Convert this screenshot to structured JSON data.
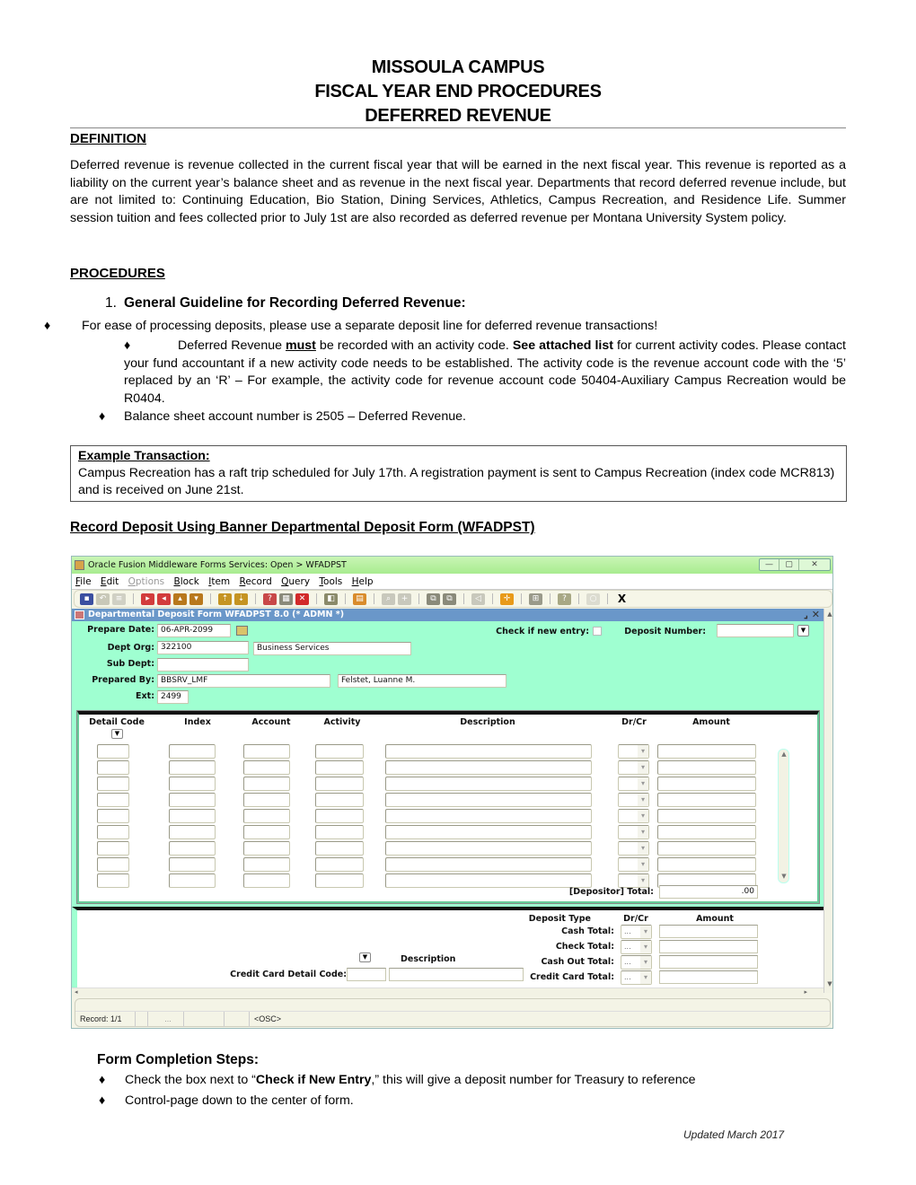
{
  "document": {
    "titles": [
      "MISSOULA CAMPUS",
      "FISCAL YEAR END PROCEDURES",
      "DEFERRED REVENUE"
    ],
    "definition": {
      "heading": "DEFINITION",
      "text": "Deferred revenue is revenue collected in the current fiscal year that will be earned in the next fiscal year. This revenue is reported as a liability on the current year’s balance sheet and as revenue in the next fiscal year. Departments that record deferred revenue include, but are not limited to: Continuing Education, Bio Station, Dining Services, Athletics, Campus Recreation, and Residence Life. Summer session tuition and fees collected prior to July 1st are also recorded as deferred revenue per Montana University System policy."
    },
    "procedures": {
      "heading": "PROCEDURES",
      "step_number": "1.",
      "step_title": "General Guideline for Recording Deferred Revenue:",
      "bullet_symbol": "♦",
      "bullet1": "For ease of processing deposits, please use a separate deposit line for deferred revenue transactions!",
      "bullet2_part1": "Deferred Revenue ",
      "bullet2_must": "must",
      "bullet2_part2": " be recorded with an activity code. ",
      "bullet2_see": "See attached list",
      "bullet2_part3": " for current activity codes. Please contact your fund accountant if a new activity code needs to be established. The activity code is the revenue account code with the ‘5’ replaced by an ‘R’ – For example, the activity code for revenue account code 50404-Auxiliary Campus Recreation would be R0404.",
      "bullet3": "Balance sheet account number is 2505 – Deferred Revenue."
    },
    "example": {
      "heading": "Example Transaction:",
      "text": "Campus Recreation has a raft trip scheduled for July 17th.  A registration payment is sent to Campus Recreation (index code MCR813) and is received on June 21st."
    },
    "record_heading": "Record Deposit Using Banner Departmental Deposit Form (WFADPST)",
    "form_completion": {
      "heading": "Form Completion Steps:",
      "step1_pre": "Check the box next to “",
      "step1_bold": "Check if New Entry",
      "step1_post": ",” this will give a deposit number for Treasury to reference",
      "step2": "Control-page down to the center of form."
    },
    "footer": "Updated March 2017"
  },
  "app": {
    "window_title": "Oracle Fusion Middleware Forms Services:  Open > WFADPST",
    "window_buttons": [
      "—",
      "▢",
      "✕"
    ],
    "menu": [
      {
        "label": "File",
        "enabled": true
      },
      {
        "label": "Edit",
        "enabled": true
      },
      {
        "label": "Options",
        "enabled": false
      },
      {
        "label": "Block",
        "enabled": true
      },
      {
        "label": "Item",
        "enabled": true
      },
      {
        "label": "Record",
        "enabled": true
      },
      {
        "label": "Query",
        "enabled": true
      },
      {
        "label": "Tools",
        "enabled": true
      },
      {
        "label": "Help",
        "enabled": true
      }
    ],
    "toolbar": [
      {
        "name": "save-icon",
        "color": "#3b4fa0",
        "glyph": "▪"
      },
      {
        "name": "rollback-icon",
        "color": "#c8c8b8",
        "glyph": "↶"
      },
      {
        "name": "print-doc-icon",
        "color": "#d0d0c4",
        "glyph": "≡"
      },
      {
        "sep": true
      },
      {
        "name": "next-block-icon",
        "color": "#d23c3c",
        "glyph": "▸"
      },
      {
        "name": "previous-block-icon",
        "color": "#d23c3c",
        "glyph": "◂"
      },
      {
        "name": "previous-record-icon",
        "color": "#b8781c",
        "glyph": "▴"
      },
      {
        "name": "next-record-icon",
        "color": "#b8781c",
        "glyph": "▾"
      },
      {
        "sep": true
      },
      {
        "name": "enter-query-icon",
        "color": "#c59422",
        "glyph": "⇡"
      },
      {
        "name": "execute-query-icon",
        "color": "#c59422",
        "glyph": "⇣"
      },
      {
        "sep": true
      },
      {
        "name": "insert-record-icon",
        "color": "#c84848",
        "glyph": "?"
      },
      {
        "name": "clear-record-icon",
        "color": "#8a8a7a",
        "glyph": "▦"
      },
      {
        "name": "delete-record-icon",
        "color": "#d22a2a",
        "glyph": "✕"
      },
      {
        "sep": true
      },
      {
        "name": "exit-form-icon",
        "color": "#8a8a6a",
        "glyph": "◧"
      },
      {
        "sep": true
      },
      {
        "name": "print-icon",
        "color": "#d98c2c",
        "glyph": "▤"
      },
      {
        "sep": true
      },
      {
        "name": "search-icon",
        "color": "#c8c8bc",
        "glyph": "⌕"
      },
      {
        "name": "add-icon",
        "color": "#c8c8bc",
        "glyph": "+"
      },
      {
        "sep": true
      },
      {
        "name": "block-navigate-icon",
        "color": "#8a8a7a",
        "glyph": "⧉"
      },
      {
        "name": "item-navigate-icon",
        "color": "#8a8a7a",
        "glyph": "⧉"
      },
      {
        "sep": true
      },
      {
        "name": "speaker-icon",
        "color": "#c8c8bc",
        "glyph": "◁"
      },
      {
        "sep": true
      },
      {
        "name": "crosshair-icon",
        "color": "#e89a1a",
        "glyph": "✛"
      },
      {
        "sep": true
      },
      {
        "name": "window-icon",
        "color": "#9a9a8a",
        "glyph": "⊞"
      },
      {
        "sep": true
      },
      {
        "name": "help-icon",
        "color": "#a8a884",
        "glyph": "?"
      },
      {
        "sep": true
      },
      {
        "name": "lightbulb-icon",
        "color": "#dcdcd0",
        "glyph": "○"
      },
      {
        "sep": true
      },
      {
        "name": "close-icon",
        "color": "transparent",
        "glyph": "X"
      }
    ],
    "form_title": "Departmental Deposit Form  WFADPST  8.0  (* ADMN *)",
    "header": {
      "prepare_date_label": "Prepare Date:",
      "prepare_date": "06-APR-2099",
      "dept_org_label": "Dept Org:",
      "dept_org": "322100",
      "dept_org_desc": "Business Services",
      "sub_dept_label": "Sub Dept:",
      "sub_dept": "",
      "prepared_by_label": "Prepared By:",
      "prepared_by": "BBSRV_LMF",
      "prepared_by_name": "Felstet, Luanne M.",
      "ext_label": "Ext:",
      "ext": "2499",
      "check_new_label": "Check if new entry:",
      "check_new_checked": false,
      "deposit_number_label": "Deposit Number:",
      "deposit_number": ""
    },
    "detail": {
      "columns": [
        "Detail Code",
        "Index",
        "Account",
        "Activity",
        "Description",
        "Dr/Cr",
        "Amount"
      ],
      "row_count": 9,
      "total_label": "[Depositor]  Total:",
      "total_value": ".00"
    },
    "lower": {
      "deposit_type_label": "Deposit Type",
      "drcr_label": "Dr/Cr",
      "amount_label": "Amount",
      "rows": [
        {
          "label": "Cash Total:",
          "drcr": "...",
          "amount": ""
        },
        {
          "label": "Check Total:",
          "drcr": "...",
          "amount": ""
        },
        {
          "label": "Cash Out Total:",
          "drcr": "...",
          "amount": ""
        },
        {
          "label": "Credit Card Total:",
          "drcr": "...",
          "amount": ""
        }
      ],
      "description_label": "Description",
      "cc_detail_code_label": "Credit Card Detail Code:",
      "cc_detail_code": "",
      "cc_description": ""
    },
    "status": {
      "record": "Record: 1/1",
      "ellipsis": "...",
      "mode": "<OSC>"
    }
  }
}
